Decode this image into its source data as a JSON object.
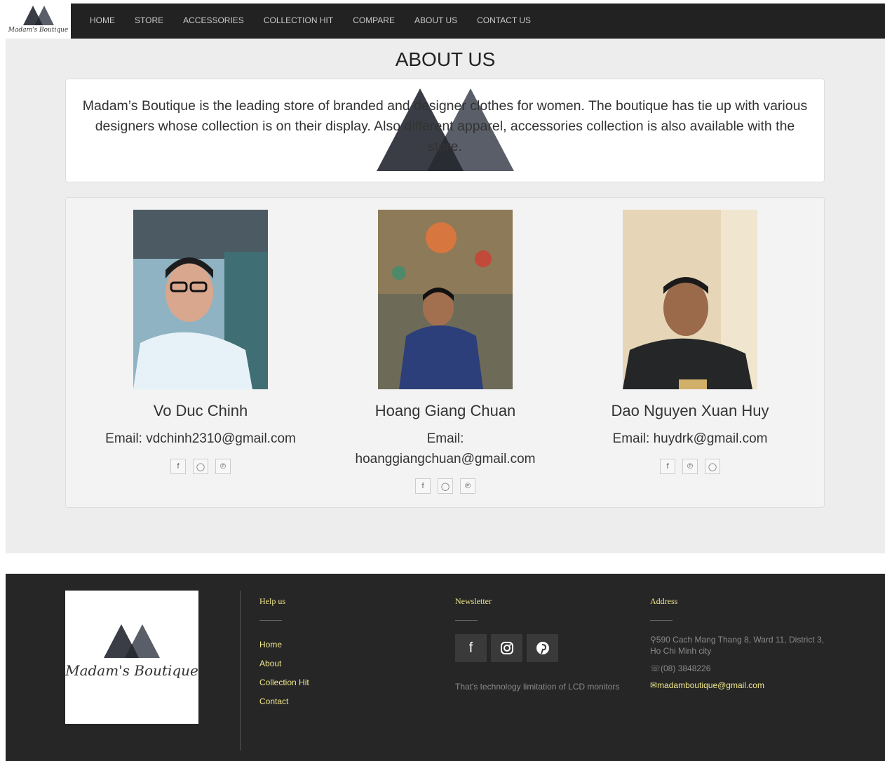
{
  "brand": {
    "name": "Madam's Boutique"
  },
  "nav": {
    "items": [
      {
        "label": "HOME"
      },
      {
        "label": "STORE"
      },
      {
        "label": "ACCESSORIES"
      },
      {
        "label": "COLLECTION HIT"
      },
      {
        "label": "COMPARE"
      },
      {
        "label": "ABOUT US"
      },
      {
        "label": "CONTACT US"
      }
    ]
  },
  "main": {
    "title": "ABOUT US",
    "intro": "Madam’s Boutique is the leading store of branded and designer clothes for women. The boutique has tie up with various designers whose collection is on their display. Also different apparel, accessories collection is also available with the store."
  },
  "team": [
    {
      "name": "Vo Duc Chinh",
      "email": "Email: vdchinh2310@gmail.com",
      "socials": [
        "facebook-icon",
        "instagram-icon",
        "pinterest-icon"
      ]
    },
    {
      "name": "Hoang Giang Chuan",
      "email": "Email: hoanggiangchuan@gmail.com",
      "socials": [
        "facebook-icon",
        "instagram-icon",
        "pinterest-icon"
      ]
    },
    {
      "name": "Dao Nguyen Xuan Huy",
      "email": "Email: huydrk@gmail.com",
      "socials": [
        "facebook-icon",
        "pinterest-icon",
        "instagram-icon"
      ]
    }
  ],
  "footer": {
    "help": {
      "title": "Help us",
      "links": [
        "Home",
        "About",
        "Collection Hit",
        "Contact"
      ]
    },
    "newsletter": {
      "title": "Newsletter",
      "note": "That's technology limitation of LCD monitors"
    },
    "address": {
      "title": "Address",
      "street": "590 Cach Mang Thang 8, Ward 11, District 3, Ho Chi Minh city",
      "phone": "(08) 3848226",
      "email": "madamboutique@gmail.com"
    }
  },
  "colors": {
    "nav_bg": "#222222",
    "footer_bg": "#262626",
    "footer_accent": "#f0e68c",
    "page_bg": "#ededed"
  }
}
